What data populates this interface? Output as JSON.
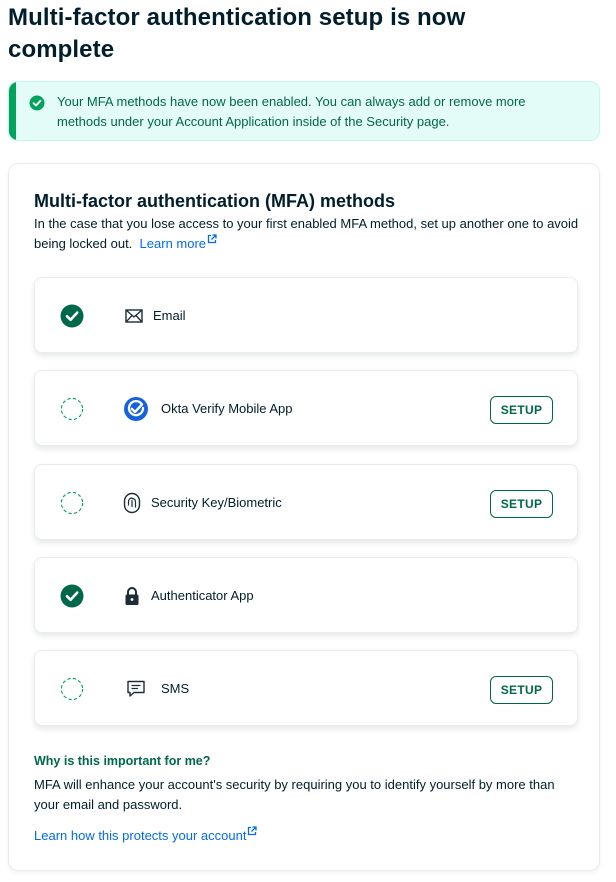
{
  "page": {
    "title": "Multi-factor authentication setup is now complete"
  },
  "banner": {
    "icon": "check-circle-icon",
    "message": "Your MFA methods have now been enabled. You can always add or remove more methods under your Account Application inside of the Security page.",
    "color": "#00684a",
    "background": "#e3fcf7"
  },
  "mfa_card": {
    "title": "Multi-factor authentication (MFA) methods",
    "description": "In the case that you lose access to your first enabled MFA method, set up another one to avoid being locked out.",
    "learn_more": "Learn more"
  },
  "methods": [
    {
      "label": "Email",
      "icon": "envelope-icon",
      "enabled": true,
      "action": ""
    },
    {
      "label": "Okta Verify Mobile App",
      "icon": "okta-verify-icon",
      "enabled": false,
      "action": "SETUP"
    },
    {
      "label": "Security Key/Biometric",
      "icon": "fingerprint-icon",
      "enabled": false,
      "action": "SETUP"
    },
    {
      "label": "Authenticator App",
      "icon": "lock-icon",
      "enabled": true,
      "action": ""
    },
    {
      "label": "SMS",
      "icon": "chat-icon",
      "enabled": false,
      "action": "SETUP"
    }
  ],
  "why": {
    "title": "Why is this important for me?",
    "text": "MFA will enhance your account's security by requiring you to identify yourself by more than your email and password.",
    "link": "Learn how this protects your account"
  },
  "colors": {
    "primary_green": "#00684a",
    "link_blue": "#016bf8",
    "text_dark": "#001e2b"
  }
}
